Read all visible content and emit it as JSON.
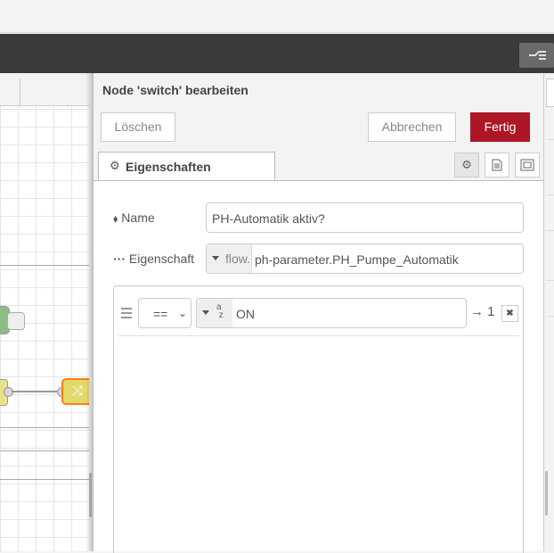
{
  "editor": {
    "title": "Node 'switch' bearbeiten",
    "buttons": {
      "delete": "Löschen",
      "cancel": "Abbrechen",
      "done": "Fertig"
    },
    "tabs": {
      "properties": "Eigenschaften"
    },
    "fields": {
      "name_label": "Name",
      "name_value": "PH-Automatik aktiv?",
      "property_label": "Eigenschaft",
      "property_type": "flow.",
      "property_value": "ph-parameter.PH_Pumpe_Automatik"
    },
    "rules": [
      {
        "operator": "==",
        "value_type": "az",
        "value": "ON",
        "output": "→ 1"
      }
    ]
  },
  "colors": {
    "header": "#3b3b3b",
    "done_button": "#ad1625",
    "switch_node": "#e2d96e",
    "switch_node_border": "#ff7f0e",
    "green_node": "#8dbb84"
  },
  "icons": [
    "gear-icon",
    "tag-icon",
    "ellipsis-icon",
    "document-icon",
    "expand-icon",
    "drag-handle-icon",
    "close-icon",
    "deploy-icon",
    "switch-icon"
  ]
}
